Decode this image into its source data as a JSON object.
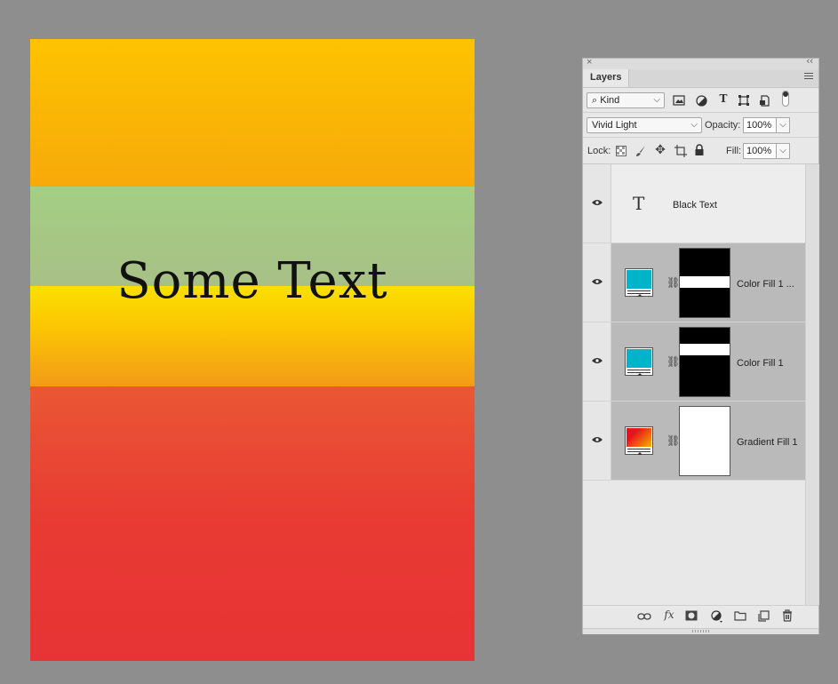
{
  "canvas": {
    "text": "Some Text"
  },
  "panel": {
    "tab_label": "Layers",
    "close_glyph": "×",
    "collapse_glyph": "‹‹",
    "filter": {
      "kind_label": "Kind",
      "search_glyph": "⌕"
    },
    "blend": {
      "mode": "Vivid Light",
      "opacity_label": "Opacity:",
      "opacity_value": "100%"
    },
    "lock": {
      "label": "Lock:",
      "fill_label": "Fill:",
      "fill_value": "100%"
    },
    "layers": [
      {
        "name": "Black Text",
        "type": "text",
        "visible": true
      },
      {
        "name": "Color Fill 1 ...",
        "type": "color-fill",
        "swatch": "#00b5c8",
        "visible": true
      },
      {
        "name": "Color Fill 1",
        "type": "color-fill",
        "swatch": "#00b5c8",
        "visible": true
      },
      {
        "name": "Gradient Fill 1",
        "type": "gradient-fill",
        "swatch": "gradient red-yellow",
        "visible": true
      }
    ],
    "footer_icons": [
      "link-icon",
      "fx-icon",
      "mask-icon",
      "adjustment-icon",
      "folder-icon",
      "new-layer-icon",
      "trash-icon"
    ]
  },
  "colors": {
    "workspace": "#8e8e8e",
    "band_top": "#fdc300",
    "band_green": "#a3cf83",
    "band_yellow": "#fbe000",
    "band_red": "#e83a33",
    "selected_layer": "#bababa",
    "cyan_swatch": "#00b5c8"
  }
}
